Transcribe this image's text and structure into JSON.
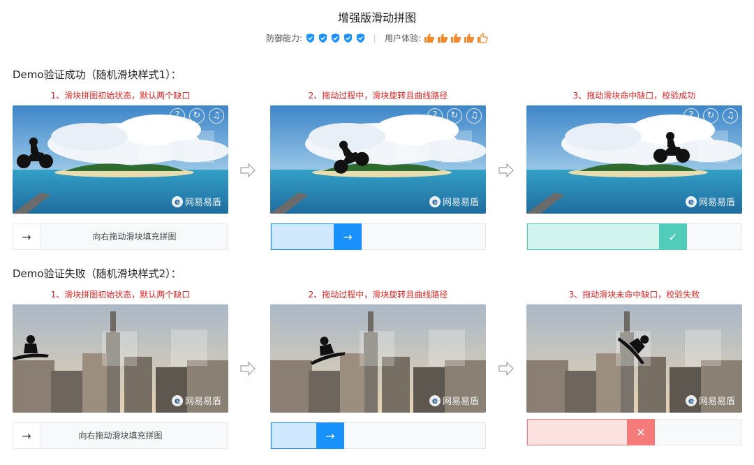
{
  "header": {
    "title": "增强版滑动拼图",
    "defense_label": "防御能力:",
    "defense_level": 5,
    "ux_label": "用户体验:",
    "ux_level": 4.5
  },
  "colors": {
    "accent_blue": "#1991fa",
    "success_green": "#52ccba",
    "fail_red": "#f57a7a",
    "rating_orange": "#f5892a",
    "step_red": "#e0201f"
  },
  "sections": [
    {
      "title": "Demo验证成功（随机滑块样式1）：",
      "steps": [
        {
          "label": "1、滑块拼图初始状态，默认两个缺口",
          "slider_hint": "向右拖动滑块填充拼图",
          "slider_state": "idle",
          "slider_progress": 0
        },
        {
          "label": "2、拖动过程中，滑块旋转且曲线路径",
          "slider_hint": "",
          "slider_state": "moving",
          "slider_progress": 0.29
        },
        {
          "label": "3、拖动滑块命中缺口，校验成功",
          "slider_hint": "",
          "slider_state": "success",
          "slider_progress": 0.73
        }
      ]
    },
    {
      "title": "Demo验证失败（随机滑块样式2）：",
      "steps": [
        {
          "label": "1、滑块拼图初始状态，默认两个缺口",
          "slider_hint": "向右拖动滑块填充拼图",
          "slider_state": "idle",
          "slider_progress": 0
        },
        {
          "label": "2、拖动过程中，滑块旋转且曲线路径",
          "slider_hint": "",
          "slider_state": "moving",
          "slider_progress": 0.21
        },
        {
          "label": "3、拖动滑块未命中缺口，校验失败",
          "slider_hint": "",
          "slider_state": "fail",
          "slider_progress": 0.49
        }
      ]
    }
  ],
  "image_icons": [
    "help-icon",
    "refresh-icon",
    "audio-icon"
  ],
  "watermark": {
    "text": "网易易盾",
    "logo_letter": "e"
  },
  "arrow_glyph": "hollow-right-arrow",
  "knob_glyphs": {
    "idle": "→",
    "moving": "→",
    "success": "✓",
    "fail": "✕"
  }
}
